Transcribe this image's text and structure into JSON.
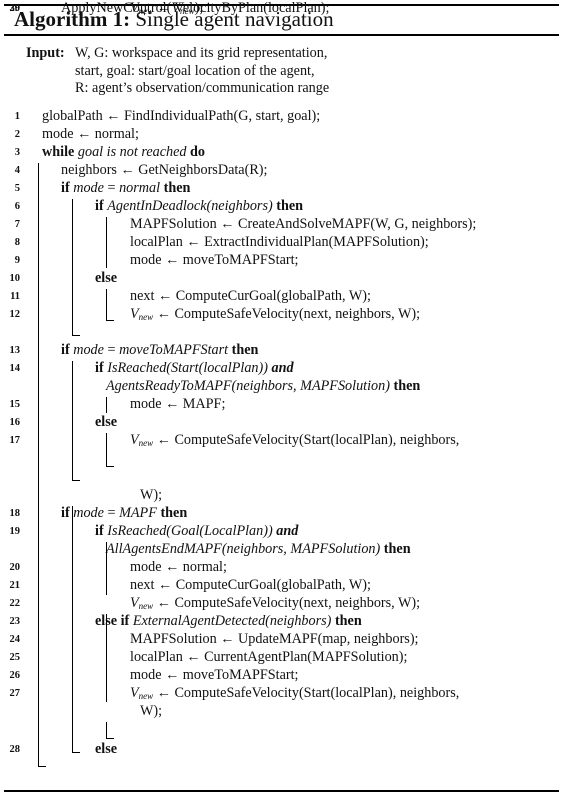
{
  "algorithm": {
    "label": "Algorithm 1:",
    "title": "Single agent navigation",
    "input_label": "Input:",
    "inputs": [
      "W, G: workspace and its grid representation,",
      "start, goal: start/goal location of the agent,",
      "R: agent’s observation/communication range"
    ],
    "lines": [
      {
        "n": "1",
        "parts": [
          [
            "t",
            "globalPath ← FindIndividualPath(G, start, goal);"
          ]
        ]
      },
      {
        "n": "2",
        "parts": [
          [
            "t",
            "mode ← normal;"
          ]
        ]
      },
      {
        "n": "3",
        "parts": [
          [
            "k",
            "while"
          ],
          [
            "t",
            " "
          ],
          [
            "i",
            "goal is not reached"
          ],
          [
            "t",
            " "
          ],
          [
            "k",
            "do"
          ]
        ]
      },
      {
        "n": "4",
        "parts": [
          [
            "t",
            "neighbors ← GetNeighborsData(R);"
          ]
        ]
      },
      {
        "n": "5",
        "parts": [
          [
            "k",
            "if"
          ],
          [
            "t",
            " "
          ],
          [
            "i",
            "mode"
          ],
          [
            "t",
            " = "
          ],
          [
            "i",
            "normal"
          ],
          [
            "t",
            " "
          ],
          [
            "k",
            "then"
          ]
        ]
      },
      {
        "n": "6",
        "parts": [
          [
            "k",
            "if"
          ],
          [
            "t",
            " "
          ],
          [
            "i",
            "AgentInDeadlock(neighbors)"
          ],
          [
            "t",
            " "
          ],
          [
            "k",
            "then"
          ]
        ]
      },
      {
        "n": "7",
        "parts": [
          [
            "t",
            "MAPFSolution ← CreateAndSolveMAPF(W, G, neighbors);"
          ]
        ]
      },
      {
        "n": "8",
        "parts": [
          [
            "t",
            "localPlan ← ExtractIndividualPlan(MAPFSolution);"
          ]
        ]
      },
      {
        "n": "9",
        "parts": [
          [
            "t",
            "mode ← moveToMAPFStart;"
          ]
        ]
      },
      {
        "n": "10",
        "parts": [
          [
            "k",
            "else"
          ]
        ]
      },
      {
        "n": "11",
        "parts": [
          [
            "t",
            "next ← ComputeCurGoal(globalPath, W);"
          ]
        ]
      },
      {
        "n": "12",
        "parts": [
          [
            "v",
            ""
          ],
          [
            "t",
            " ← ComputeSafeVelocity(next, neighbors, W);"
          ]
        ]
      },
      {
        "n": "13",
        "parts": [
          [
            "k",
            "if"
          ],
          [
            "t",
            " "
          ],
          [
            "i",
            "mode"
          ],
          [
            "t",
            " = "
          ],
          [
            "i",
            "moveToMAPFStart"
          ],
          [
            "t",
            " "
          ],
          [
            "k",
            "then"
          ]
        ]
      },
      {
        "n": "14",
        "parts": [
          [
            "k",
            "if"
          ],
          [
            "t",
            " "
          ],
          [
            "i",
            "IsReached(Start(localPlan))"
          ],
          [
            "t",
            " "
          ],
          [
            "ki",
            "and"
          ]
        ]
      },
      {
        "n": "",
        "parts": [
          [
            "i",
            "AgentsReadyToMAPF(neighbors, MAPFSolution)"
          ],
          [
            "t",
            " "
          ],
          [
            "k",
            "then"
          ]
        ]
      },
      {
        "n": "15",
        "parts": [
          [
            "t",
            "mode ← MAPF;"
          ]
        ]
      },
      {
        "n": "16",
        "parts": [
          [
            "k",
            "else"
          ]
        ]
      },
      {
        "n": "17",
        "parts": [
          [
            "v",
            ""
          ],
          [
            "t",
            " ← ComputeSafeVelocity(Start(localPlan), neighbors,"
          ]
        ]
      },
      {
        "n": "",
        "parts": [
          [
            "t",
            "W);"
          ]
        ]
      },
      {
        "n": "18",
        "parts": [
          [
            "k",
            "if"
          ],
          [
            "t",
            " "
          ],
          [
            "i",
            "mode"
          ],
          [
            "t",
            " = "
          ],
          [
            "i",
            "MAPF"
          ],
          [
            "t",
            " "
          ],
          [
            "k",
            "then"
          ]
        ]
      },
      {
        "n": "19",
        "parts": [
          [
            "k",
            "if"
          ],
          [
            "t",
            " "
          ],
          [
            "i",
            "IsReached(Goal(LocalPlan))"
          ],
          [
            "t",
            " "
          ],
          [
            "ki",
            "and"
          ]
        ]
      },
      {
        "n": "",
        "parts": [
          [
            "i",
            "AllAgentsEndMAPF(neighbors, MAPFSolution)"
          ],
          [
            "t",
            " "
          ],
          [
            "k",
            "then"
          ]
        ]
      },
      {
        "n": "20",
        "parts": [
          [
            "t",
            "mode ← normal;"
          ]
        ]
      },
      {
        "n": "21",
        "parts": [
          [
            "t",
            "next ← ComputeCurGoal(globalPath, W);"
          ]
        ]
      },
      {
        "n": "22",
        "parts": [
          [
            "v",
            ""
          ],
          [
            "t",
            " ← ComputeSafeVelocity(next, neighbors, W);"
          ]
        ]
      },
      {
        "n": "23",
        "parts": [
          [
            "k",
            "else if"
          ],
          [
            "t",
            " "
          ],
          [
            "i",
            "ExternalAgentDetected(neighbors)"
          ],
          [
            "t",
            " "
          ],
          [
            "k",
            "then"
          ]
        ]
      },
      {
        "n": "24",
        "parts": [
          [
            "t",
            "MAPFSolution ← UpdateMAPF(map, neighbors);"
          ]
        ]
      },
      {
        "n": "25",
        "parts": [
          [
            "t",
            "localPlan ← CurrentAgentPlan(MAPFSolution);"
          ]
        ]
      },
      {
        "n": "26",
        "parts": [
          [
            "t",
            "mode ← moveToMAPFStart;"
          ]
        ]
      },
      {
        "n": "27",
        "parts": [
          [
            "v",
            ""
          ],
          [
            "t",
            " ← ComputeSafeVelocity(Start(localPlan), neighbors,"
          ]
        ]
      },
      {
        "n": "",
        "parts": [
          [
            "t",
            "W);"
          ]
        ]
      },
      {
        "n": "28",
        "parts": [
          [
            "k",
            "else"
          ]
        ]
      },
      {
        "n": "29",
        "parts": [
          [
            "v",
            ""
          ],
          [
            "t",
            " ← VelocityByPlan(localPlan);"
          ]
        ]
      },
      {
        "n": "30",
        "parts": [
          [
            "t",
            "ApplyNewControl("
          ],
          [
            "v",
            ""
          ],
          [
            "t",
            ");"
          ]
        ]
      }
    ],
    "velocity_symbol": {
      "base": "V",
      "sub": "new"
    }
  }
}
